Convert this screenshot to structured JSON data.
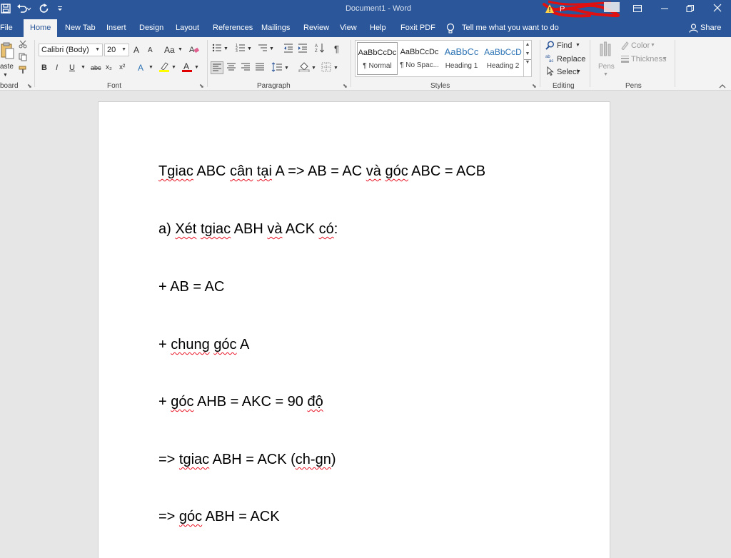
{
  "titlebar": {
    "title": "Document1  -  Word",
    "signin": "P",
    "icons": [
      "save-icon",
      "undo-icon",
      "redo-icon",
      "customize-qat-icon"
    ]
  },
  "tabs": [
    "File",
    "Home",
    "New Tab",
    "Insert",
    "Design",
    "Layout",
    "References",
    "Mailings",
    "Review",
    "View",
    "Help",
    "Foxit PDF"
  ],
  "tellme": "Tell me what you want to do",
  "share": "Share",
  "ribbon": {
    "clipboard": {
      "paste": "aste",
      "label": "board"
    },
    "font": {
      "name": "Calibri (Body)",
      "size": "20",
      "grow": "A",
      "shrink": "A",
      "case": "Aa",
      "bold": "B",
      "italic": "I",
      "underline": "U",
      "strike": "abc",
      "sub": "x₂",
      "sup": "x²",
      "effects": "A",
      "color": "A",
      "label": "Font"
    },
    "paragraph": {
      "label": "Paragraph",
      "pilcrow": "¶"
    },
    "styles": {
      "items": [
        {
          "sample": "AaBbCcDc",
          "name": "¶ Normal"
        },
        {
          "sample": "AaBbCcDc",
          "name": "¶ No Spac..."
        },
        {
          "sample": "AaBbCc",
          "name": "Heading 1"
        },
        {
          "sample": "AaBbCcD",
          "name": "Heading 2"
        }
      ],
      "label": "Styles"
    },
    "editing": {
      "find": "Find",
      "replace": "Replace",
      "select": "Select",
      "label": "Editing"
    },
    "pens": {
      "pens": "Pens",
      "color": "Color",
      "thickness": "Thickness",
      "label": "Pens"
    }
  },
  "document": {
    "paragraphs": [
      [
        [
          "Tgiac",
          1
        ],
        [
          " ABC ",
          0
        ],
        [
          "cân",
          1
        ],
        [
          " ",
          0
        ],
        [
          "tại",
          1
        ],
        [
          " A => AB = AC ",
          0
        ],
        [
          "và",
          1
        ],
        [
          " ",
          0
        ],
        [
          "góc",
          1
        ],
        [
          " ABC = ACB",
          0
        ]
      ],
      [
        [
          "a) ",
          0
        ],
        [
          "Xét",
          1
        ],
        [
          " ",
          0
        ],
        [
          "tgiac",
          1
        ],
        [
          " ABH ",
          0
        ],
        [
          "và",
          1
        ],
        [
          " ACK ",
          0
        ],
        [
          "có",
          1
        ],
        [
          ":",
          0
        ]
      ],
      [
        [
          "+ AB = AC",
          0
        ]
      ],
      [
        [
          "+ ",
          0
        ],
        [
          "chung",
          1
        ],
        [
          " ",
          0
        ],
        [
          "góc",
          1
        ],
        [
          " A",
          0
        ]
      ],
      [
        [
          "+ ",
          0
        ],
        [
          "góc",
          1
        ],
        [
          " AHB = AKC = 90 ",
          0
        ],
        [
          "độ",
          1
        ]
      ],
      [
        [
          "=> ",
          0
        ],
        [
          "tgiac",
          1
        ],
        [
          " ABH = ACK (",
          0
        ],
        [
          "ch-gn",
          1
        ],
        [
          ")",
          0
        ]
      ],
      [
        [
          "=> ",
          0
        ],
        [
          "góc",
          1
        ],
        [
          " ABH = ACK",
          0
        ]
      ]
    ]
  },
  "colors": {
    "word_blue": "#2b579a",
    "ribbon_bg": "#f3f3f3",
    "canvas_bg": "#e6e6e6",
    "spell_squiggle": "#e81123",
    "highlight_yellow": "#ffff00",
    "font_color_red": "#e00000"
  }
}
